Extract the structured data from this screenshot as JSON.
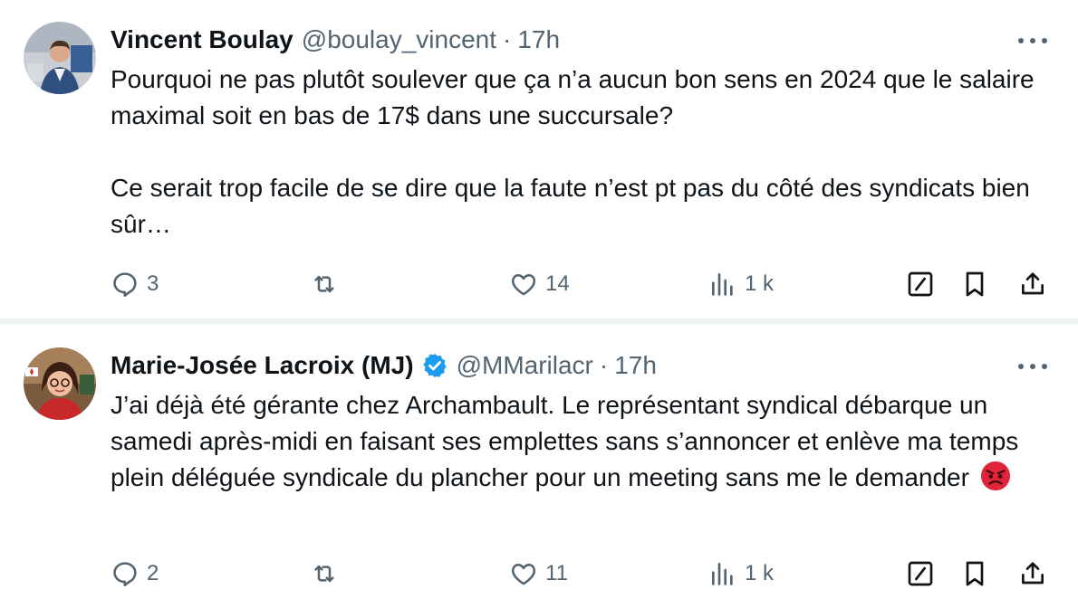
{
  "tweets": [
    {
      "author_name": "Vincent Boulay",
      "handle": "@boulay_vincent",
      "separator": "·",
      "time": "17h",
      "verified": false,
      "paragraphs": [
        "Pourquoi ne pas plutôt soulever que ça n’a aucun bon sens en 2024 que le salaire maximal soit en bas de 17$ dans une succursale?",
        "Ce serait trop facile de se dire que la faute n’est pt pas du côté des syndicats bien sûr…"
      ],
      "stats": {
        "replies": "3",
        "reposts": "",
        "likes": "14",
        "views": "1 k"
      }
    },
    {
      "author_name": "Marie-Josée Lacroix (MJ)",
      "handle": "@MMarilacr",
      "separator": "·",
      "time": "17h",
      "verified": true,
      "paragraphs": [
        "J’ai déjà été gérante chez Archambault. Le représentant syndical débarque un samedi après-midi en faisant ses emplettes sans s’annoncer et enlève ma temps plein déléguée syndicale du plancher pour un meeting sans me le demander"
      ],
      "emoji": "angry-face-emoji",
      "stats": {
        "replies": "2",
        "reposts": "",
        "likes": "11",
        "views": "1 k"
      }
    }
  ],
  "colors": {
    "text": "#0f1419",
    "secondary": "#536471",
    "verified": "#1d9bf0",
    "divider": "#eff3f4",
    "emoji": "#e0243a"
  },
  "icons": [
    "reply-icon",
    "repost-icon",
    "like-icon",
    "views-icon",
    "grok-icon",
    "bookmark-icon",
    "share-icon",
    "more-icon",
    "verified-badge-icon"
  ]
}
